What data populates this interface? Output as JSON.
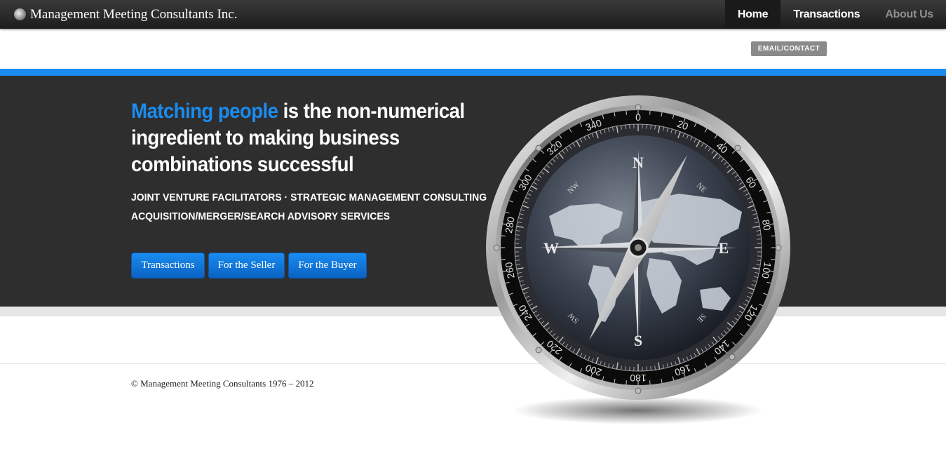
{
  "brand": {
    "name": "Management Meeting Consultants Inc."
  },
  "nav": [
    {
      "label": "Home"
    },
    {
      "label": "Transactions"
    },
    {
      "label": "About Us"
    }
  ],
  "email_tab": {
    "label": "EMAIL/CONTACT"
  },
  "hero": {
    "headline_highlight": "Matching people",
    "headline_rest": " is the non-numerical ingredient to making business combinations successful",
    "subline1": "JOINT VENTURE FACILITATORS · STRATEGIC MANAGEMENT CONSULTING",
    "subline2": "ACQUISITION/MERGER/SEARCH ADVISORY SERVICES",
    "buttons": [
      {
        "label": "Transactions"
      },
      {
        "label": "For the Seller"
      },
      {
        "label": "For the Buyer"
      }
    ]
  },
  "compass": {
    "cardinals": [
      "N",
      "E",
      "S",
      "W"
    ],
    "intercardinals": [
      "NE",
      "SE",
      "SW",
      "NW"
    ],
    "degree_labels": [
      "0",
      "20",
      "40",
      "60",
      "80",
      "100",
      "120",
      "140",
      "160",
      "180",
      "200",
      "220",
      "240",
      "260",
      "280",
      "300",
      "320",
      "340"
    ]
  },
  "footer": {
    "copyright": "© Management Meeting Consultants 1976 – 2012"
  },
  "colors": {
    "accent": "#1a8cf0",
    "hero_bg": "#2e2e2e",
    "nav_bg": "#232323"
  }
}
